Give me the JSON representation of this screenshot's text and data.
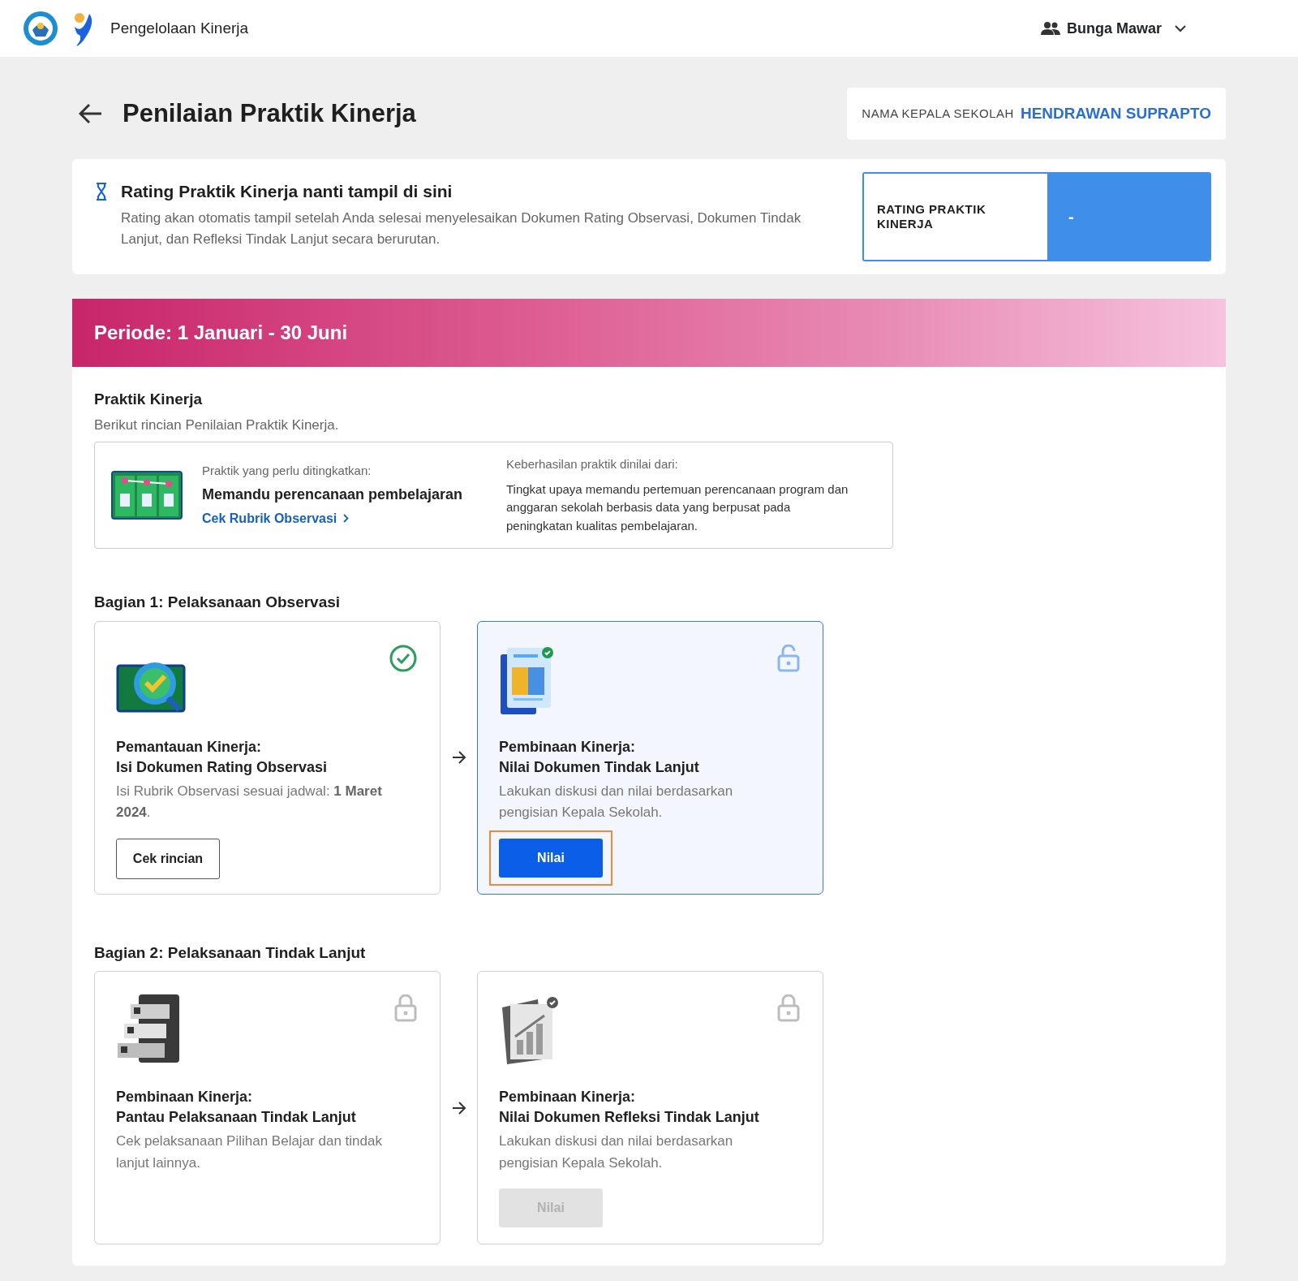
{
  "header": {
    "app_name": "Pengelolaan Kinerja",
    "user_name": "Bunga Mawar"
  },
  "page": {
    "title": "Penilaian Praktik Kinerja",
    "principal_label": "NAMA KEPALA SEKOLAH",
    "principal_name": "HENDRAWAN SUPRAPTO"
  },
  "rating_notice": {
    "title": "Rating Praktik Kinerja nanti tampil di sini",
    "description": "Rating akan otomatis tampil setelah Anda selesai menyelesaikan Dokumen Rating Observasi, Dokumen Tindak Lanjut, dan Refleksi Tindak Lanjut secara berurutan.",
    "rating_label": "RATING PRAKTIK KINERJA",
    "rating_value": "-"
  },
  "period": {
    "title": "Periode: 1 Januari - 30 Juni"
  },
  "practice": {
    "heading": "Praktik Kinerja",
    "subheading": "Berikut rincian Penilaian Praktik Kinerja.",
    "improve_label": "Praktik yang perlu ditingkatkan:",
    "improve_title": "Memandu perencanaan pembelajaran",
    "rubric_link": "Cek Rubrik Observasi",
    "criteria_label": "Keberhasilan praktik dinilai dari:",
    "criteria_text": "Tingkat upaya memandu pertemuan perencanaan program dan anggaran sekolah berbasis data yang berpusat pada peningkatan kualitas pembelajaran."
  },
  "sections": [
    {
      "title": "Bagian 1: Pelaksanaan Observasi",
      "steps": [
        {
          "title": "Pemantauan Kinerja:",
          "subtitle": "Isi Dokumen Rating Observasi",
          "description": "Isi Rubrik Observasi sesuai jadwal: **1 Maret 2024**.",
          "completed": true,
          "locked": false,
          "selected": false,
          "button": {
            "label": "Cek rincian",
            "kind": "outline",
            "disabled": false,
            "highlighted": false
          }
        },
        {
          "title": "Pembinaan Kinerja:",
          "subtitle": "Nilai Dokumen Tindak Lanjut",
          "description": "Lakukan diskusi dan nilai berdasarkan pengisian Kepala Sekolah.",
          "completed": false,
          "locked": false,
          "selected": true,
          "button": {
            "label": "Nilai",
            "kind": "primary",
            "disabled": false,
            "highlighted": true
          }
        }
      ]
    },
    {
      "title": "Bagian 2: Pelaksanaan Tindak Lanjut",
      "steps": [
        {
          "title": "Pembinaan Kinerja:",
          "subtitle": "Pantau Pelaksanaan Tindak Lanjut",
          "description": "Cek pelaksanaan Pilihan Belajar dan tindak lanjut lainnya.",
          "completed": false,
          "locked": true,
          "selected": false
        },
        {
          "title": "Pembinaan Kinerja:",
          "subtitle": "Nilai Dokumen Refleksi Tindak Lanjut",
          "description": "Lakukan diskusi dan nilai berdasarkan pengisian Kepala Sekolah.",
          "completed": false,
          "locked": true,
          "selected": false,
          "button": {
            "label": "Nilai",
            "kind": "primary",
            "disabled": true,
            "highlighted": false
          }
        }
      ]
    }
  ]
}
